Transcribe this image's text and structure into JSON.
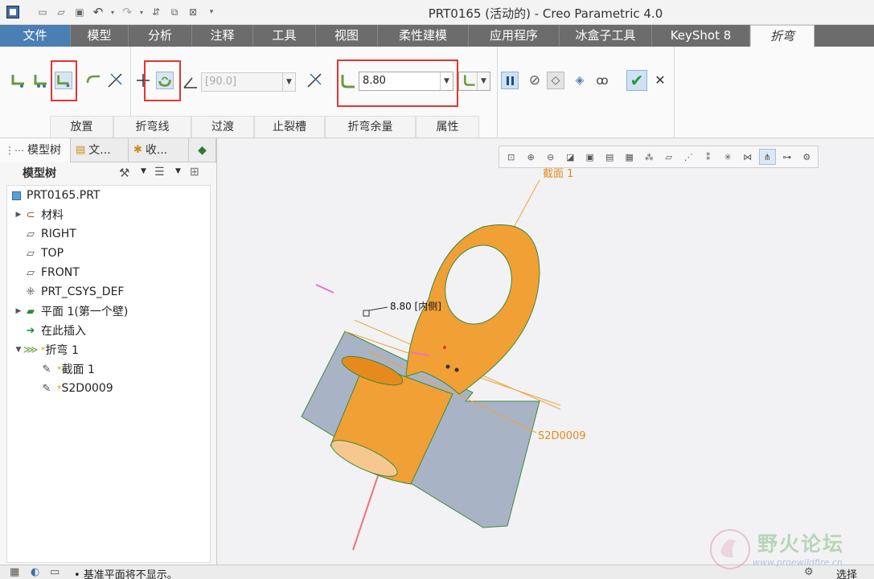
{
  "window": {
    "title": "PRT0165 (活动的) - Creo Parametric 4.0"
  },
  "ribbon_tabs": [
    {
      "label": "文件"
    },
    {
      "label": "模型"
    },
    {
      "label": "分析"
    },
    {
      "label": "注释"
    },
    {
      "label": "工具"
    },
    {
      "label": "视图"
    },
    {
      "label": "柔性建模"
    },
    {
      "label": "应用程序"
    },
    {
      "label": "冰盒子工具"
    },
    {
      "label": "KeyShot 8"
    },
    {
      "label": "折弯"
    }
  ],
  "ribbon": {
    "angle_value": "[90.0]",
    "radius_value": "8.80",
    "groups": [
      {
        "label": "放置"
      },
      {
        "label": "折弯线"
      },
      {
        "label": "过渡"
      },
      {
        "label": "止裂槽"
      },
      {
        "label": "折弯余量"
      },
      {
        "label": "属性"
      }
    ]
  },
  "left_panel": {
    "tabs": [
      {
        "label": "模型树"
      },
      {
        "label": "文..."
      },
      {
        "label": "收..."
      }
    ],
    "tree_title": "模型树",
    "nodes": [
      {
        "label": "PRT0165.PRT",
        "icon": "part-icon"
      },
      {
        "label": "材料",
        "icon": "material-icon"
      },
      {
        "label": "RIGHT",
        "icon": "datum-plane-icon"
      },
      {
        "label": "TOP",
        "icon": "datum-plane-icon"
      },
      {
        "label": "FRONT",
        "icon": "datum-plane-icon"
      },
      {
        "label": "PRT_CSYS_DEF",
        "icon": "csys-icon"
      },
      {
        "label": "平面 1(第一个壁)",
        "icon": "wall-icon"
      },
      {
        "label": "在此插入",
        "icon": "insert-arrow-icon"
      },
      {
        "label": "折弯 1",
        "icon": "bend-icon"
      },
      {
        "label": "截面 1",
        "icon": "sketch-icon"
      },
      {
        "label": "S2D0009",
        "icon": "sketch-icon"
      }
    ],
    "new_marker": "*"
  },
  "graphics": {
    "labels": {
      "section": "截面 1",
      "dimension": "8.80 [内侧]",
      "sketch": "S2D0009"
    }
  },
  "statusbar": {
    "message": "• 基准平面将不显示。",
    "filter": "选择"
  },
  "watermark": {
    "text": "野火论坛",
    "url": "www.proewildfire.cn"
  },
  "colors": {
    "accent": "#4a7fb4",
    "highlight_box": "#e53333",
    "part": "#f0a035",
    "wall": "#a9b3c6"
  }
}
